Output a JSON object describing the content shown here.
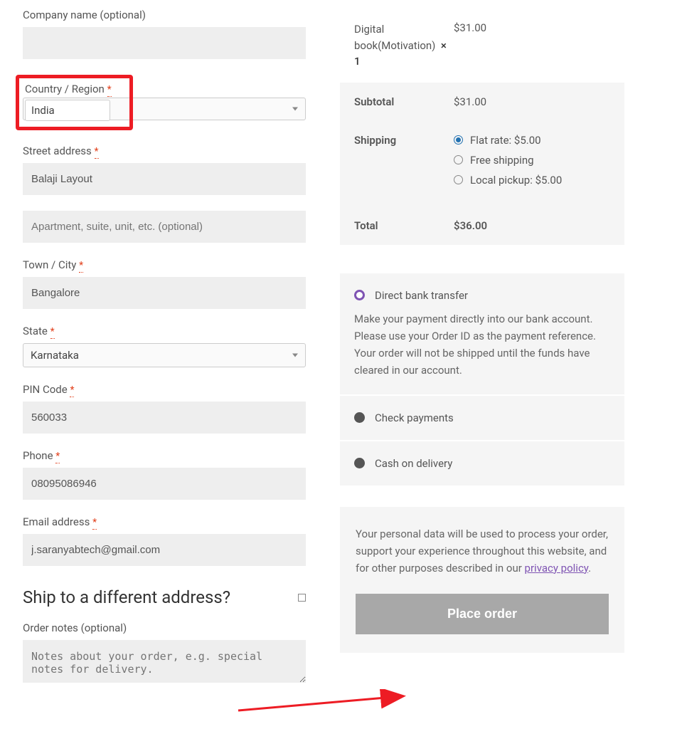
{
  "billing": {
    "company_label": "Company name (optional)",
    "company_value": "",
    "country_label": "Country / Region",
    "country_value": "India",
    "street_label": "Street address",
    "street_value": "Balaji Layout",
    "street2_placeholder": "Apartment, suite, unit, etc. (optional)",
    "city_label": "Town / City",
    "city_value": "Bangalore",
    "state_label": "State",
    "state_value": "Karnataka",
    "pin_label": "PIN Code",
    "pin_value": "560033",
    "phone_label": "Phone",
    "phone_value": "08095086946",
    "email_label": "Email address",
    "email_value": "j.saranyabtech@gmail.com",
    "required_mark": "*"
  },
  "shipping_section": {
    "heading": "Ship to a different address?",
    "notes_label": "Order notes (optional)",
    "notes_placeholder": "Notes about your order, e.g. special notes for delivery."
  },
  "order": {
    "product_name": "Digital book(Motivation)",
    "product_qty": "× 1",
    "product_price": "$31.00",
    "subtotal_label": "Subtotal",
    "subtotal_value": "$31.00",
    "shipping_label": "Shipping",
    "shipping_options": [
      {
        "label": "Flat rate: $5.00",
        "checked": true
      },
      {
        "label": "Free shipping",
        "checked": false
      },
      {
        "label": "Local pickup: $5.00",
        "checked": false
      }
    ],
    "total_label": "Total",
    "total_value": "$36.00"
  },
  "payment": {
    "options": [
      {
        "label": "Direct bank transfer",
        "selected": true
      },
      {
        "label": "Check payments",
        "selected": false
      },
      {
        "label": "Cash on delivery",
        "selected": false
      }
    ],
    "bank_desc": "Make your payment directly into our bank account. Please use your Order ID as the payment reference. Your order will not be shipped until the funds have cleared in our account."
  },
  "privacy": {
    "text_before": "Your personal data will be used to process your order, support your experience throughout this website, and for other purposes described in our ",
    "link_text": "privacy policy",
    "text_after": "."
  },
  "place_order_label": "Place order"
}
